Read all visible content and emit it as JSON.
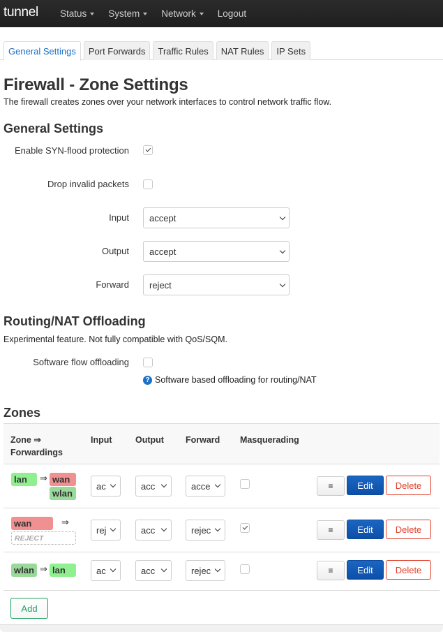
{
  "nav": {
    "brand": "tunnel",
    "items": [
      {
        "label": "Status",
        "dropdown": true
      },
      {
        "label": "System",
        "dropdown": true
      },
      {
        "label": "Network",
        "dropdown": true
      },
      {
        "label": "Logout",
        "dropdown": false
      }
    ]
  },
  "tabs": [
    {
      "label": "General Settings",
      "active": true
    },
    {
      "label": "Port Forwards",
      "active": false
    },
    {
      "label": "Traffic Rules",
      "active": false
    },
    {
      "label": "NAT Rules",
      "active": false
    },
    {
      "label": "IP Sets",
      "active": false
    }
  ],
  "page": {
    "title": "Firewall - Zone Settings",
    "description": "The firewall creates zones over your network interfaces to control network traffic flow."
  },
  "general": {
    "heading": "General Settings",
    "syn_flood": {
      "label": "Enable SYN-flood protection",
      "checked": true
    },
    "drop_invalid": {
      "label": "Drop invalid packets",
      "checked": false
    },
    "input": {
      "label": "Input",
      "value": "accept"
    },
    "output": {
      "label": "Output",
      "value": "accept"
    },
    "forward": {
      "label": "Forward",
      "value": "reject"
    }
  },
  "offloading": {
    "heading": "Routing/NAT Offloading",
    "description": "Experimental feature. Not fully compatible with QoS/SQM.",
    "software_flow": {
      "label": "Software flow offloading",
      "checked": false
    },
    "help_icon": "question-circle-icon",
    "help_text": "Software based offloading for routing/NAT"
  },
  "zones": {
    "heading": "Zones",
    "columns": {
      "zone_line1": "Zone ⇒",
      "zone_line2": "Forwardings",
      "input": "Input",
      "output": "Output",
      "forward": "Forward",
      "masquerading": "Masquerading"
    },
    "arrow": "⇒",
    "rows": [
      {
        "zone": "lan",
        "forwardings": [
          "wan",
          "wlan"
        ],
        "input": "ac",
        "output": "acc",
        "forward": "acce",
        "masquerading": false
      },
      {
        "zone": "wan",
        "forwardings": [
          "REJECT"
        ],
        "input": "rej",
        "output": "acc",
        "forward": "rejec",
        "masquerading": true
      },
      {
        "zone": "wlan",
        "forwardings": [
          "lan"
        ],
        "input": "ac",
        "output": "acc",
        "forward": "rejec",
        "masquerading": false
      }
    ],
    "actions": {
      "menu_icon": "≡",
      "edit": "Edit",
      "delete": "Delete"
    },
    "add_label": "Add"
  },
  "colors": {
    "accent": "#1c70c6",
    "zone_lan": "#90f090",
    "zone_wan": "#f09090",
    "zone_wlan": "#99d999",
    "edit_button": "#0d4fa8",
    "delete_button": "#e0402a",
    "add_button": "#1ea05c"
  }
}
